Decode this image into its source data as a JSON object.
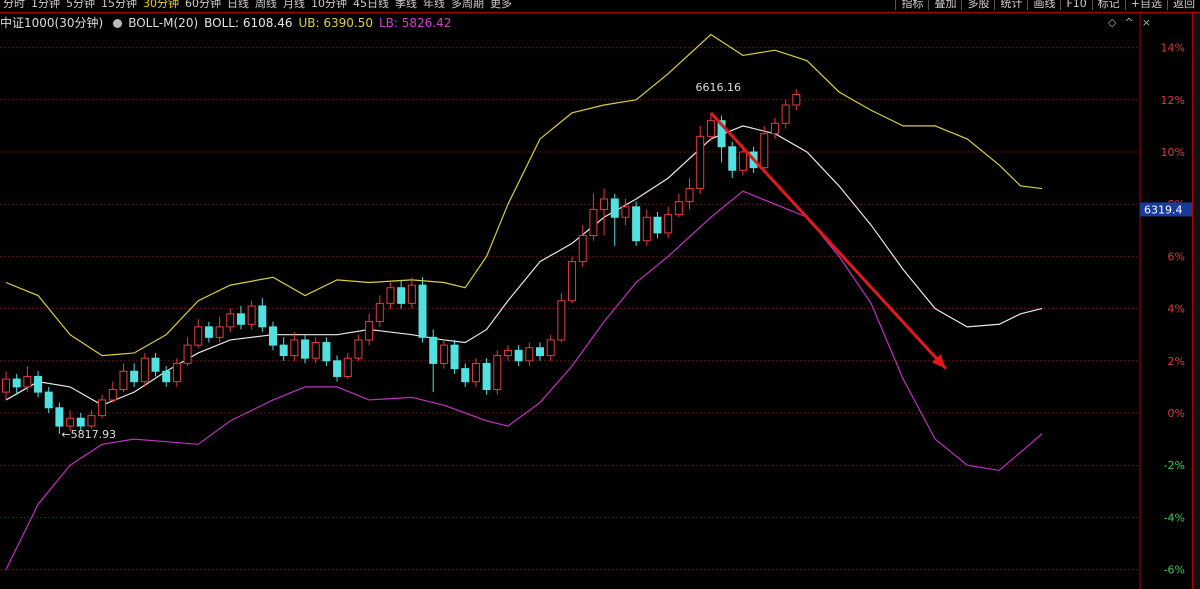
{
  "top_bar": {
    "periods": [
      {
        "label": "分时",
        "active": false
      },
      {
        "label": "1分钟",
        "active": false
      },
      {
        "label": "5分钟",
        "active": false
      },
      {
        "label": "15分钟",
        "active": false
      },
      {
        "label": "30分钟",
        "active": true
      },
      {
        "label": "60分钟",
        "active": false
      },
      {
        "label": "日线",
        "active": false
      },
      {
        "label": "周线",
        "active": false
      },
      {
        "label": "月线",
        "active": false
      },
      {
        "label": "10分钟",
        "active": false
      },
      {
        "label": "45日线",
        "active": false
      },
      {
        "label": "季线",
        "active": false
      },
      {
        "label": "年线",
        "active": false
      },
      {
        "label": "多周期",
        "active": false
      },
      {
        "label": "更多",
        "active": false
      }
    ],
    "tools": [
      "指标",
      "叠加",
      "多股",
      "统计",
      "画线",
      "F10",
      "标记",
      "+自选",
      "返回"
    ]
  },
  "info_bar": {
    "index_name": "中证1000(30分钟)",
    "indicator": "BOLL-M(20)",
    "boll_label": "BOLL: 6108.46",
    "ub_label": "UB: 6390.50",
    "lb_label": "LB: 5826.42"
  },
  "colors": {
    "up": "#e63b3b",
    "down": "#53e0e0",
    "mid": "#e8e8e8",
    "upper": "#d8d040",
    "lower": "#c030c0",
    "grid": "#6a1010",
    "arrow": "#e01a1a",
    "axis_up": "#d83a3a",
    "axis_down": "#3acc4a"
  },
  "chart_data": {
    "type": "candlestick",
    "title": "中证1000(30分钟)",
    "indicator": "BOLL-M(20)",
    "y_axis_percent_ticks": [
      "14%",
      "12%",
      "10%",
      "8%",
      "6%",
      "4%",
      "2%",
      "0%",
      "-2%",
      "-4%",
      "-6%"
    ],
    "y_percent_range": [
      -6,
      14
    ],
    "current_price_label": "6319.4",
    "annotations": {
      "high": {
        "label": "6616.16",
        "x_index": 64,
        "pct": 12.5
      },
      "low": {
        "label": "←5817.93",
        "x_index": 5,
        "pct": -0.8
      }
    },
    "trend_arrow": {
      "from": {
        "x_index": 66,
        "pct": 11.5
      },
      "to": {
        "x_index": 88,
        "pct": 1.7
      }
    },
    "bands": {
      "upper": [
        [
          0,
          5
        ],
        [
          3,
          4.5
        ],
        [
          6,
          3
        ],
        [
          9,
          2.2
        ],
        [
          12,
          2.3
        ],
        [
          15,
          3
        ],
        [
          18,
          4.3
        ],
        [
          21,
          4.9
        ],
        [
          25,
          5.2
        ],
        [
          28,
          4.5
        ],
        [
          31,
          5.1
        ],
        [
          34,
          5
        ],
        [
          38,
          5.1
        ],
        [
          41,
          5
        ],
        [
          43,
          4.8
        ],
        [
          45,
          6
        ],
        [
          47,
          8
        ],
        [
          50,
          10.5
        ],
        [
          53,
          11.5
        ],
        [
          56,
          11.8
        ],
        [
          59,
          12
        ],
        [
          62,
          13
        ],
        [
          66,
          14.5
        ],
        [
          69,
          13.7
        ],
        [
          72,
          13.9
        ],
        [
          75,
          13.5
        ],
        [
          78,
          12.3
        ],
        [
          81,
          11.6
        ],
        [
          84,
          11
        ],
        [
          87,
          11
        ],
        [
          90,
          10.5
        ],
        [
          93,
          9.5
        ],
        [
          95,
          8.7
        ],
        [
          97,
          8.6
        ]
      ],
      "mid": [
        [
          0,
          0.5
        ],
        [
          3,
          1.2
        ],
        [
          6,
          1
        ],
        [
          9,
          0.3
        ],
        [
          12,
          0.8
        ],
        [
          15,
          1.6
        ],
        [
          18,
          2.3
        ],
        [
          21,
          2.8
        ],
        [
          25,
          3
        ],
        [
          28,
          3
        ],
        [
          31,
          3
        ],
        [
          34,
          3.2
        ],
        [
          38,
          3
        ],
        [
          41,
          2.8
        ],
        [
          43,
          2.7
        ],
        [
          45,
          3.2
        ],
        [
          47,
          4.3
        ],
        [
          50,
          5.8
        ],
        [
          53,
          6.5
        ],
        [
          56,
          7.5
        ],
        [
          59,
          8.2
        ],
        [
          62,
          9
        ],
        [
          66,
          10.5
        ],
        [
          69,
          11
        ],
        [
          72,
          10.7
        ],
        [
          75,
          10
        ],
        [
          78,
          8.7
        ],
        [
          81,
          7.2
        ],
        [
          84,
          5.5
        ],
        [
          87,
          4
        ],
        [
          90,
          3.3
        ],
        [
          93,
          3.4
        ],
        [
          95,
          3.8
        ],
        [
          97,
          4
        ]
      ],
      "lower": [
        [
          0,
          -6
        ],
        [
          3,
          -3.5
        ],
        [
          6,
          -2
        ],
        [
          9,
          -1.2
        ],
        [
          12,
          -1
        ],
        [
          15,
          -1.1
        ],
        [
          18,
          -1.2
        ],
        [
          21,
          -0.3
        ],
        [
          25,
          0.5
        ],
        [
          28,
          1
        ],
        [
          31,
          1
        ],
        [
          34,
          0.5
        ],
        [
          38,
          0.6
        ],
        [
          41,
          0.3
        ],
        [
          43,
          0
        ],
        [
          45,
          -0.3
        ],
        [
          47,
          -0.5
        ],
        [
          50,
          0.4
        ],
        [
          53,
          1.8
        ],
        [
          56,
          3.5
        ],
        [
          59,
          5
        ],
        [
          62,
          6
        ],
        [
          66,
          7.5
        ],
        [
          69,
          8.5
        ],
        [
          72,
          8
        ],
        [
          75,
          7.5
        ],
        [
          78,
          6
        ],
        [
          81,
          4.2
        ],
        [
          84,
          1.3
        ],
        [
          87,
          -1
        ],
        [
          90,
          -2
        ],
        [
          93,
          -2.2
        ],
        [
          95,
          -1.5
        ],
        [
          97,
          -0.8
        ]
      ]
    },
    "candles": [
      [
        0.8,
        1.3,
        0.5,
        1.6
      ],
      [
        1.3,
        1.0,
        0.7,
        1.5
      ],
      [
        1.0,
        1.4,
        0.8,
        1.8
      ],
      [
        1.4,
        0.8,
        0.6,
        1.6
      ],
      [
        0.8,
        0.2,
        0.0,
        1.0
      ],
      [
        0.2,
        -0.5,
        -0.8,
        0.4
      ],
      [
        -0.5,
        -0.2,
        -0.7,
        0.1
      ],
      [
        -0.2,
        -0.5,
        -0.7,
        0.0
      ],
      [
        -0.5,
        -0.1,
        -0.6,
        0.1
      ],
      [
        -0.1,
        0.5,
        -0.2,
        0.7
      ],
      [
        0.5,
        0.9,
        0.4,
        1.2
      ],
      [
        0.9,
        1.6,
        0.8,
        1.9
      ],
      [
        1.6,
        1.2,
        1.0,
        1.9
      ],
      [
        1.2,
        2.1,
        1.0,
        2.3
      ],
      [
        2.1,
        1.6,
        1.4,
        2.3
      ],
      [
        1.6,
        1.2,
        1.0,
        1.8
      ],
      [
        1.2,
        1.9,
        1.0,
        2.1
      ],
      [
        1.9,
        2.6,
        1.8,
        2.9
      ],
      [
        2.6,
        3.3,
        2.5,
        3.6
      ],
      [
        3.3,
        2.9,
        2.7,
        3.5
      ],
      [
        2.9,
        3.3,
        2.7,
        3.7
      ],
      [
        3.3,
        3.8,
        3.1,
        4.0
      ],
      [
        3.8,
        3.4,
        3.2,
        4.1
      ],
      [
        3.4,
        4.1,
        3.2,
        4.3
      ],
      [
        4.1,
        3.3,
        3.1,
        4.4
      ],
      [
        3.3,
        2.6,
        2.4,
        3.5
      ],
      [
        2.6,
        2.2,
        2.0,
        2.9
      ],
      [
        2.2,
        2.8,
        2.0,
        3.1
      ],
      [
        2.8,
        2.1,
        1.9,
        3.0
      ],
      [
        2.1,
        2.7,
        1.9,
        2.9
      ],
      [
        2.7,
        2.0,
        1.8,
        2.9
      ],
      [
        2.0,
        1.4,
        1.2,
        2.2
      ],
      [
        1.4,
        2.1,
        1.3,
        2.3
      ],
      [
        2.1,
        2.8,
        2.0,
        3.0
      ],
      [
        2.8,
        3.5,
        2.6,
        3.8
      ],
      [
        3.5,
        4.2,
        3.3,
        4.5
      ],
      [
        4.2,
        4.8,
        4.0,
        5.0
      ],
      [
        4.8,
        4.2,
        4.0,
        5.1
      ],
      [
        4.2,
        4.9,
        4.0,
        5.2
      ],
      [
        4.9,
        2.9,
        2.7,
        5.2
      ],
      [
        2.9,
        1.9,
        0.8,
        3.2
      ],
      [
        1.9,
        2.6,
        1.7,
        2.8
      ],
      [
        2.6,
        1.7,
        1.5,
        2.8
      ],
      [
        1.7,
        1.2,
        1.0,
        1.9
      ],
      [
        1.2,
        1.9,
        1.0,
        2.1
      ],
      [
        1.9,
        0.9,
        0.7,
        2.1
      ],
      [
        0.9,
        2.2,
        0.7,
        2.4
      ],
      [
        2.2,
        2.4,
        2.0,
        2.6
      ],
      [
        2.4,
        2.0,
        1.8,
        2.6
      ],
      [
        2.0,
        2.5,
        1.8,
        2.7
      ],
      [
        2.5,
        2.2,
        2.0,
        2.7
      ],
      [
        2.2,
        2.8,
        2.0,
        3.0
      ],
      [
        2.8,
        4.3,
        2.7,
        4.6
      ],
      [
        4.3,
        5.8,
        4.2,
        6.0
      ],
      [
        5.8,
        6.8,
        5.6,
        7.2
      ],
      [
        6.8,
        7.8,
        6.6,
        8.4
      ],
      [
        7.8,
        8.2,
        6.8,
        8.6
      ],
      [
        8.2,
        7.5,
        6.4,
        8.4
      ],
      [
        7.5,
        7.9,
        7.2,
        8.2
      ],
      [
        7.9,
        6.6,
        6.4,
        8.1
      ],
      [
        6.6,
        7.5,
        6.4,
        7.8
      ],
      [
        7.5,
        6.9,
        6.7,
        7.7
      ],
      [
        6.9,
        7.6,
        6.7,
        7.9
      ],
      [
        7.6,
        8.1,
        7.5,
        8.4
      ],
      [
        8.1,
        8.6,
        7.8,
        9.0
      ],
      [
        8.6,
        10.6,
        8.4,
        11.0
      ],
      [
        10.6,
        11.2,
        10.4,
        11.5
      ],
      [
        11.2,
        10.2,
        9.6,
        11.4
      ],
      [
        10.2,
        9.3,
        9.0,
        10.4
      ],
      [
        9.3,
        10.0,
        9.1,
        10.3
      ],
      [
        10.0,
        9.4,
        9.2,
        10.2
      ],
      [
        9.4,
        10.7,
        9.2,
        11.0
      ],
      [
        10.7,
        11.1,
        10.5,
        11.3
      ],
      [
        11.1,
        11.8,
        10.9,
        12.0
      ],
      [
        11.8,
        12.2,
        11.6,
        12.4
      ]
    ]
  }
}
